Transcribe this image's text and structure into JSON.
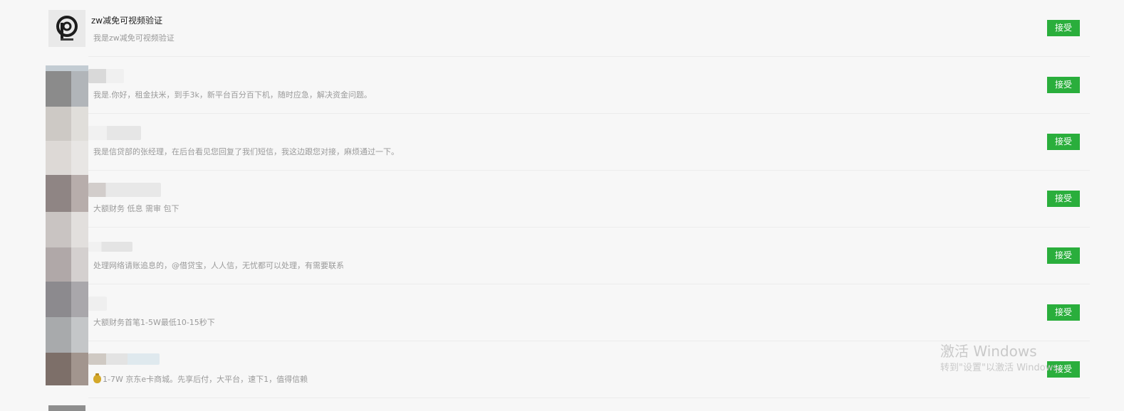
{
  "requests": [
    {
      "name": "zw减免可视频验证",
      "message": "我是zw减免可视频验证",
      "accept_label": "接受",
      "avatar": "logo-icon"
    },
    {
      "name": "",
      "message": "我是.你好，租金扶米，到手3k，新平台百分百下机，随时应急，解决资金问题。",
      "accept_label": "接受",
      "avatar": "blurred-avatar"
    },
    {
      "name": "",
      "message": "我是信贷部的张经理，在后台看见您回复了我们短信，我这边跟您对接，麻烦通过一下。",
      "accept_label": "接受",
      "avatar": "blurred-avatar"
    },
    {
      "name": "",
      "message": "大额财务 低息 需审 包下",
      "accept_label": "接受",
      "avatar": "blurred-avatar"
    },
    {
      "name": "",
      "message": "处理网络请账追息的，@借贷宝，人人信，无忧都可以处理，有需要联系",
      "accept_label": "接受",
      "avatar": "blurred-avatar"
    },
    {
      "name": "",
      "message": "大额财务首笔1-5W最低10-15秒下",
      "accept_label": "接受",
      "avatar": "blurred-avatar"
    },
    {
      "name": "",
      "message": "1-7W  京东e卡商城。先享后付，大平台，速下1，值得信赖",
      "accept_label": "接受",
      "avatar": "blurred-avatar",
      "prefix_icon": "money-bag-icon"
    }
  ],
  "watermark": {
    "line1": "激活 Windows",
    "line2": "转到\"设置\"以激活 Windows。"
  }
}
